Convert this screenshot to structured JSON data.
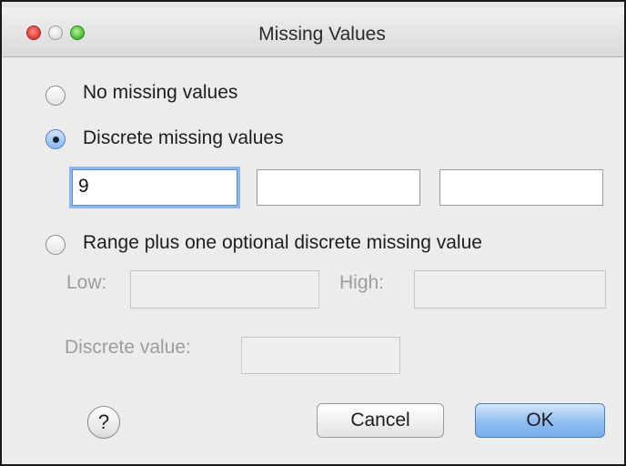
{
  "window": {
    "title": "Missing Values"
  },
  "options": {
    "no_missing_label": "No missing values",
    "discrete_label": "Discrete missing values",
    "range_label": "Range plus one optional discrete missing value",
    "selected": "discrete"
  },
  "discrete_values": [
    "9",
    "",
    ""
  ],
  "range": {
    "low_label": "Low:",
    "low_value": "",
    "high_label": "High:",
    "high_value": "",
    "discrete_value_label": "Discrete value:",
    "discrete_value": ""
  },
  "buttons": {
    "help_label": "?",
    "cancel_label": "Cancel",
    "ok_label": "OK"
  },
  "icons": {
    "close": "close-icon",
    "minimize": "minimize-icon",
    "zoom": "zoom-icon",
    "help": "help-icon"
  },
  "colors": {
    "close": "#e0443a",
    "zoom": "#53c13a",
    "focus_ring": "#8fb7ec",
    "default_button": "#8fbdf0"
  }
}
